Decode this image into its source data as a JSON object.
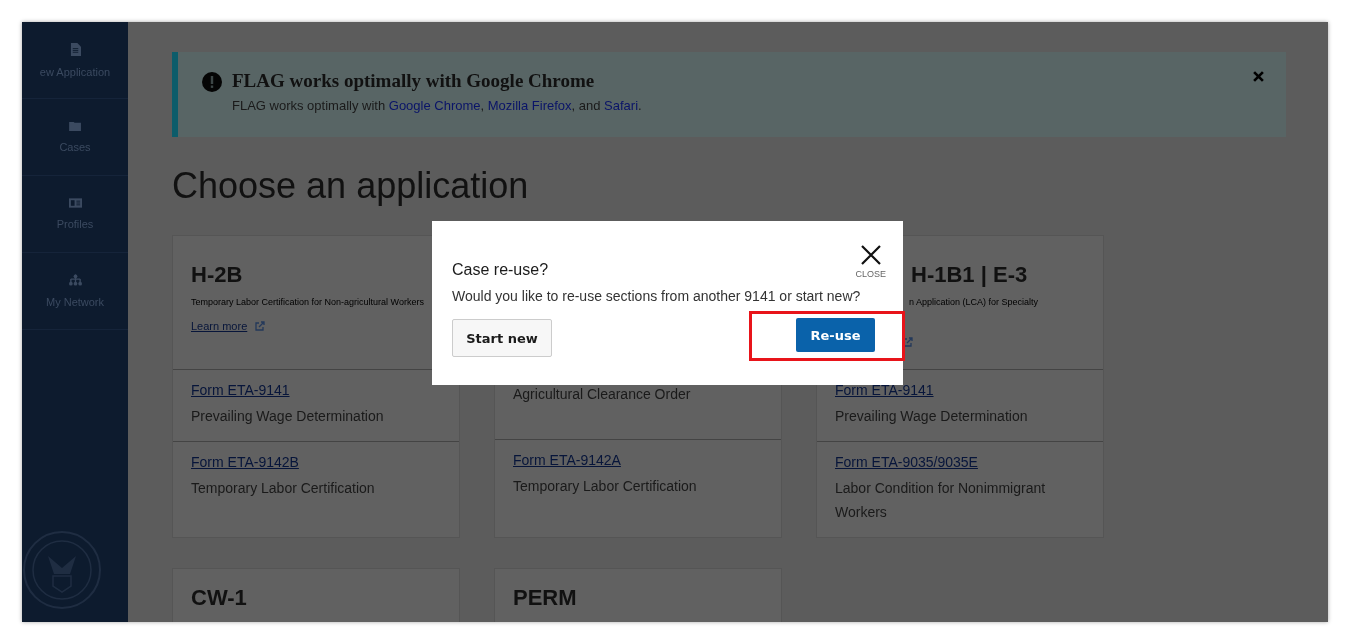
{
  "sidebar": {
    "items": [
      {
        "label": "ew Application"
      },
      {
        "label": "Cases"
      },
      {
        "label": "Profiles"
      },
      {
        "label": "My Network"
      }
    ]
  },
  "banner": {
    "title": "FLAG works optimally with Google Chrome",
    "parts": [
      {
        "text": "FLAG works optimally with ",
        "link": false
      },
      {
        "text": "Google Chrome",
        "link": true
      },
      {
        "text": ", ",
        "link": false
      },
      {
        "text": "Mozilla Firefox",
        "link": true
      },
      {
        "text": ", and ",
        "link": false
      },
      {
        "text": "Safari",
        "link": true
      },
      {
        "text": ".",
        "link": false
      }
    ]
  },
  "heading": "Choose an application",
  "cards": [
    {
      "title": "H-2B",
      "description": "Temporary Labor Certification for Non-agricultural Workers",
      "learn_more": "Learn more",
      "rows": [
        {
          "link": "Form ETA-9141",
          "description": "Prevailing Wage Determination"
        },
        {
          "link": "Form ETA-9142B",
          "description": "Temporary Labor Certification"
        }
      ]
    },
    {
      "rows": [
        {
          "description": "Agricultural Clearance Order"
        },
        {
          "link": "Form ETA-9142A",
          "description": "Temporary Labor Certification"
        }
      ]
    },
    {
      "title": "H-1B1 | E-3",
      "description": "n Application (LCA) for Specialty",
      "rows": [
        {
          "link": "Form ETA-9141",
          "description": "Prevailing Wage Determination"
        },
        {
          "link": "Form ETA-9035/9035E",
          "description": "Labor Condition for Nonimmigrant Workers"
        }
      ]
    }
  ],
  "bottom_cards": [
    {
      "title": "CW-1"
    },
    {
      "title": "PERM"
    }
  ],
  "modal": {
    "title": "Case re-use?",
    "close_label": "CLOSE",
    "message": "Would you like to re-use sections from another 9141 or start new?",
    "buttons": [
      {
        "label": "Start new",
        "kind": "secondary",
        "highlighted": false
      },
      {
        "label": "Re-use",
        "kind": "primary",
        "highlighted": true
      }
    ]
  }
}
